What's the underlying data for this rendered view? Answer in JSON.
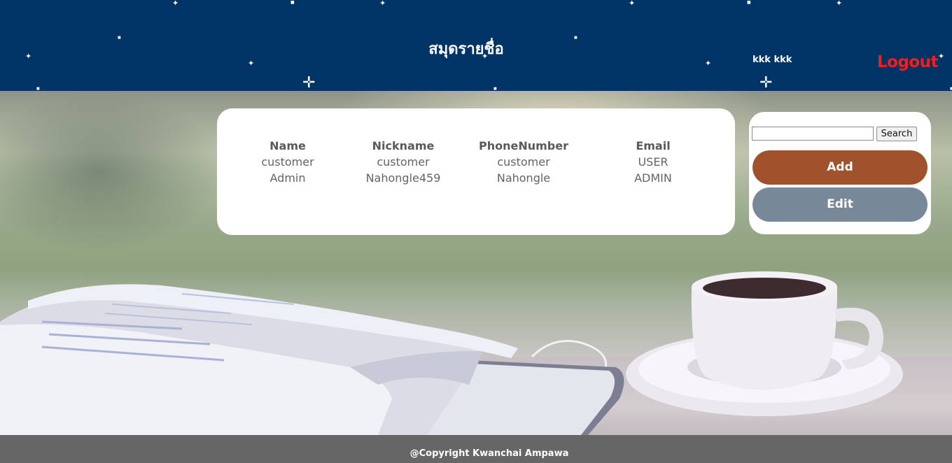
{
  "header": {
    "title": "สมุดรายชื่อ",
    "user_name": "kkk kkk",
    "logout_label": "Logout"
  },
  "table": {
    "columns": [
      "Name",
      "Nickname",
      "PhoneNumber",
      "Email"
    ],
    "rows": [
      [
        "customer",
        "customer",
        "customer",
        "USER"
      ],
      [
        "Admin",
        "Nahongle459",
        "Nahongle",
        "ADMIN"
      ]
    ]
  },
  "sidebar": {
    "search_value": "",
    "search_button_label": "Search",
    "add_label": "Add",
    "edit_label": "Edit"
  },
  "footer": {
    "copyright": "@Copyright Kwanchai Ampawa"
  },
  "colors": {
    "header_bg": "#003366",
    "logout": "#ff1a1a",
    "add_button": "#a0522d",
    "edit_button": "#778899",
    "footer_bg": "#666666"
  }
}
